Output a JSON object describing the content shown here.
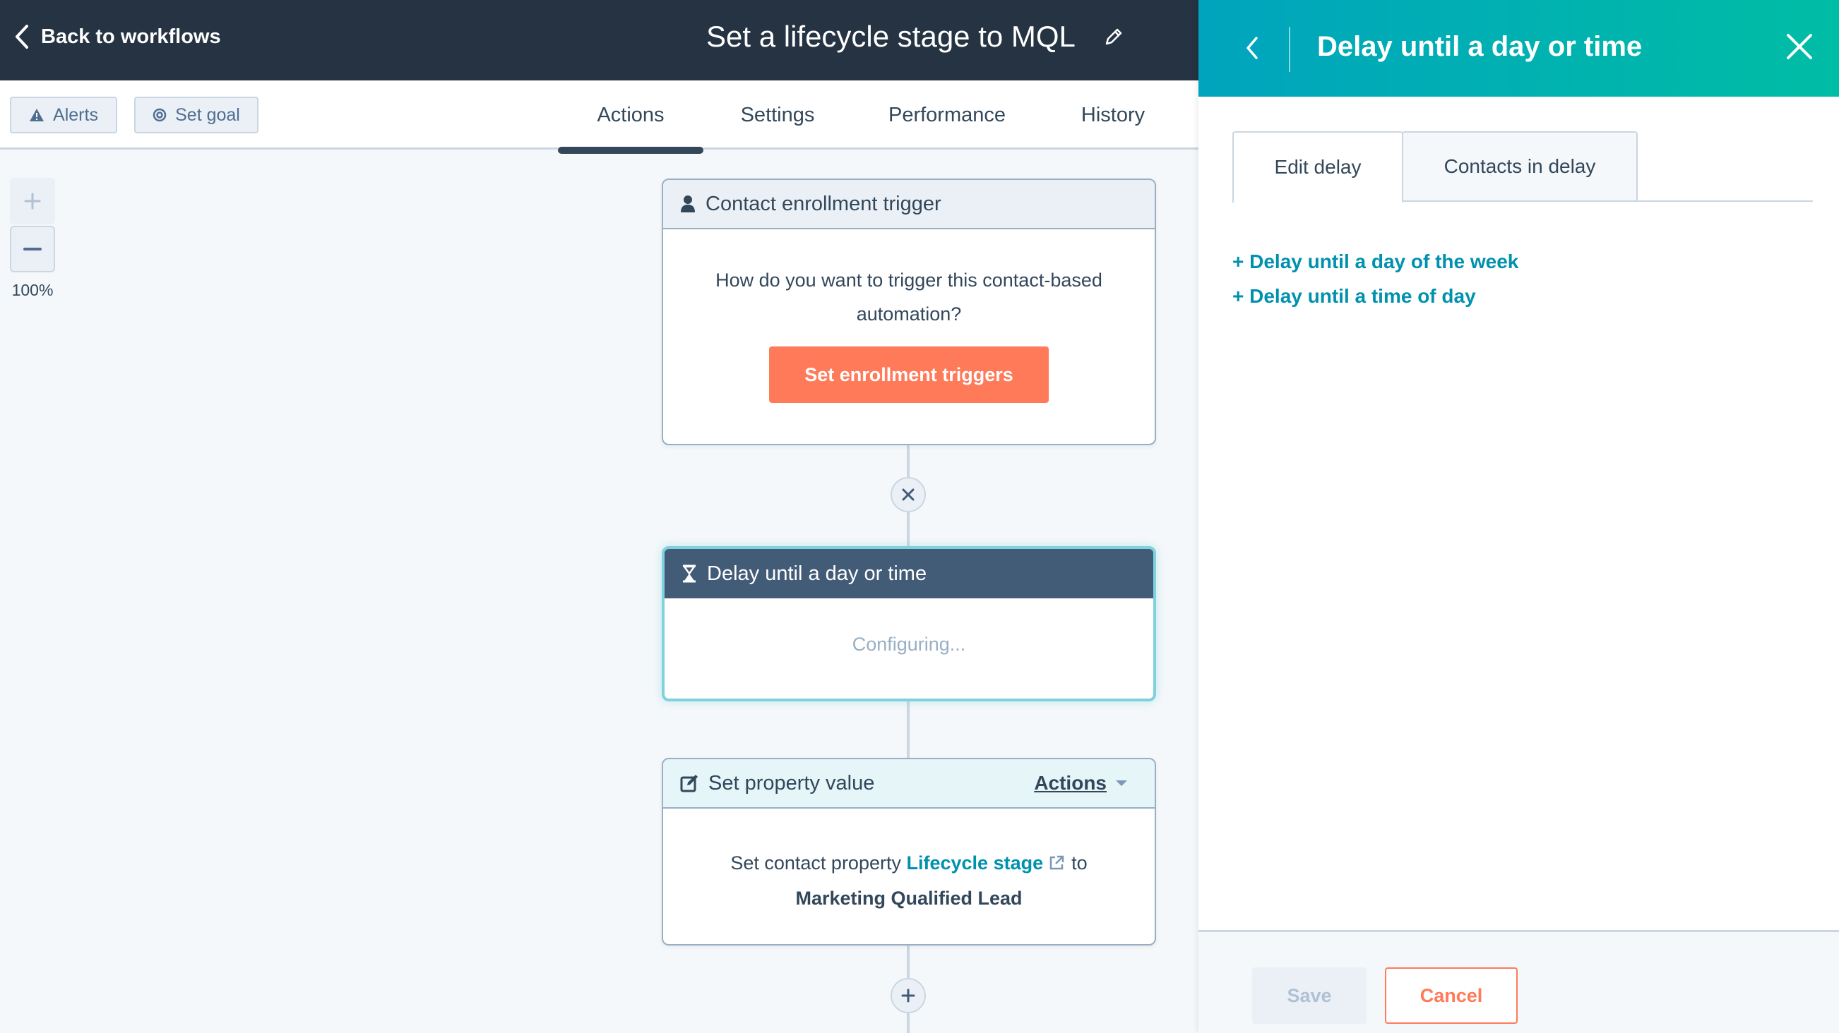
{
  "header": {
    "back_label": "Back to workflows",
    "workflow_title": "Set a lifecycle stage to MQL",
    "edit_icon": "pencil-icon"
  },
  "toolbar": {
    "alerts_label": "Alerts",
    "alerts_icon": "warning-icon",
    "set_goal_label": "Set goal",
    "set_goal_icon": "target-icon"
  },
  "tabs": [
    {
      "label": "Actions",
      "active": true
    },
    {
      "label": "Settings",
      "active": false
    },
    {
      "label": "Performance",
      "active": false
    },
    {
      "label": "History",
      "active": false
    }
  ],
  "zoom": {
    "zoom_in_icon": "plus-icon",
    "zoom_out_icon": "minus-icon",
    "level": "100%"
  },
  "flow": {
    "trigger": {
      "title": "Contact enrollment trigger",
      "icon": "contact-icon",
      "prompt": "How do you want to trigger this contact-based automation?",
      "button_label": "Set enrollment triggers"
    },
    "remove_connector_icon": "close-icon",
    "delay": {
      "title": "Delay until a day or time",
      "icon": "hourglass-icon",
      "status": "Configuring..."
    },
    "set_property": {
      "title": "Set property value",
      "icon": "edit-icon",
      "actions_label": "Actions",
      "text_prefix": "Set contact property",
      "property_link": "Lifecycle stage",
      "text_suffix": "to",
      "value": "Marketing Qualified Lead"
    },
    "add_action_icon": "plus-icon"
  },
  "panel": {
    "title": "Delay until a day or time",
    "tabs": [
      {
        "label": "Edit delay",
        "active": true
      },
      {
        "label": "Contacts in delay",
        "active": false
      }
    ],
    "options": [
      "+ Delay until a day of the week",
      "+ Delay until a time of day"
    ],
    "save_label": "Save",
    "cancel_label": "Cancel"
  },
  "colors": {
    "topbar": "#253342",
    "accent_orange": "#ff7a59",
    "link_teal": "#0091ae",
    "panel_gradient_start": "#00a4bd",
    "panel_gradient_end": "#00bda5",
    "selected_border": "#7fd1de"
  }
}
